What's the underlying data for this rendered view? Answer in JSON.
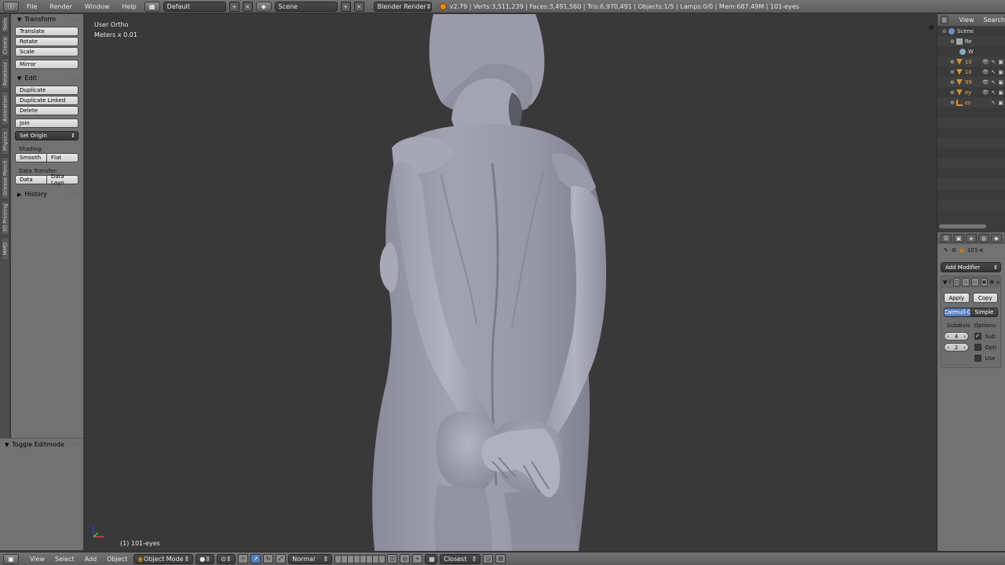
{
  "topbar": {
    "editor_icon": "info-icon",
    "menus": [
      "File",
      "Render",
      "Window",
      "Help"
    ],
    "screen_layout": "Default",
    "scene": "Scene",
    "render_engine": "Blender Render",
    "stats": "v2.79 | Verts:3,511,239 | Faces:3,491,560 | Tris:6,970,491 | Objects:1/5 | Lamps:0/0 | Mem:687.49M | 101-eyes"
  },
  "tool_tabs": [
    "Tools",
    "Create",
    "Relations",
    "Animation",
    "Physics",
    "Grease Pencil",
    "3D Printing",
    "MMD"
  ],
  "toolshelf": {
    "transform": {
      "header": "Transform",
      "buttons": [
        "Translate",
        "Rotate",
        "Scale",
        "Mirror"
      ]
    },
    "edit": {
      "header": "Edit",
      "buttons": [
        "Duplicate",
        "Duplicate Linked",
        "Delete",
        "Join"
      ],
      "set_origin": "Set Origin",
      "shading_label": "Shading:",
      "shading_buttons": [
        "Smooth",
        "Flat"
      ],
      "data_transfer_label": "Data Transfer:",
      "data_transfer_buttons": [
        "Data",
        "Data Layo"
      ]
    },
    "history": {
      "header": "History"
    }
  },
  "last_operator": {
    "header": "Toggle Editmode"
  },
  "viewport": {
    "view_name": "User Ortho",
    "units": "Meters x 0.01",
    "object_label": "(1) 101-eyes"
  },
  "outliner": {
    "header": [
      "View",
      "Search"
    ],
    "rows": [
      {
        "label": "Scene",
        "icon": "scene-icon",
        "indent": 0
      },
      {
        "label": "Re",
        "icon": "render-layers-icon",
        "indent": 1
      },
      {
        "label": "W",
        "icon": "world-icon",
        "indent": 1
      },
      {
        "label": "10",
        "icon": "mesh-object-icon",
        "indent": 1
      },
      {
        "label": "10",
        "icon": "mesh-object-icon",
        "indent": 1
      },
      {
        "label": "99",
        "icon": "mesh-object-icon",
        "indent": 1
      },
      {
        "label": "ey",
        "icon": "mesh-object-icon",
        "indent": 1
      },
      {
        "label": "zz",
        "icon": "armature-icon",
        "indent": 1
      }
    ]
  },
  "properties": {
    "context_object": "101-e",
    "add_modifier": "Add Modifier",
    "apply": "Apply",
    "copy": "Copy",
    "subdivision_types": [
      "Catmull-C",
      "Simple"
    ],
    "subdivisions_label": "Subdivis",
    "options_label": "Options:",
    "view_levels": "4",
    "render_levels": "2",
    "options": [
      "Sub",
      "Opti",
      "Use"
    ],
    "accent_color": "#5680c2"
  },
  "bottombar": {
    "menus": [
      "View",
      "Select",
      "Add",
      "Object"
    ],
    "mode": "Object Mode",
    "pivot": "Normal",
    "snap": "Closest"
  },
  "colors": {
    "viewport_bg": "#393939",
    "panel_bg": "#727272",
    "header_bg": "#636363",
    "model_gray": "#9a9aaa"
  }
}
